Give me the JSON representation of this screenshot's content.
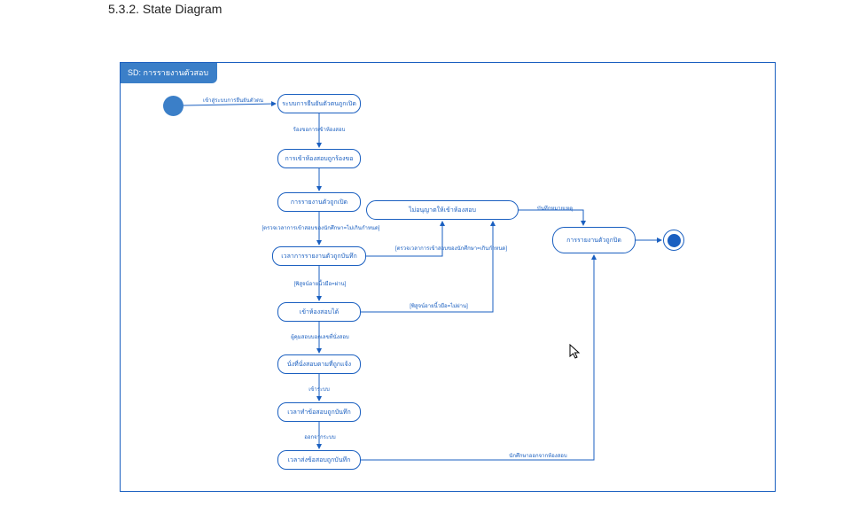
{
  "section_title": "5.3.2. State Diagram",
  "frame_label": "SD: การรายงานตัวสอบ",
  "nodes": {
    "n1": "ระบบการยืนยันตัวตนถูกเปิด",
    "n2": "การเข้าห้องสอบถูกร้องขอ",
    "n3": "การรายงานตัวถูกเปิด",
    "n4": "เวลาการรายงานตัวถูกบันทึก",
    "n5": "เข้าห้องสอบได้",
    "n6": "นั่งที่นั่งสอบตามที่ถูกแจ้ง",
    "n7": "เวลาทำข้อสอบถูกบันทึก",
    "n8": "เวลาส่งข้อสอบถูกบันทึก",
    "n9": "ไม่อนุญาตให้เข้าห้องสอบ",
    "n10": "การรายงานตัวถูกปิด"
  },
  "edges": {
    "e_start": "เข้าสู่ระบบการยืนยันตัวตน",
    "e_12": "ร้องขอการเข้าห้องสอบ",
    "e_34": "[ตรวจเวลาการเข้าสอบของนักศึกษา=ไม่เกินกำหนด]",
    "e_49": "[ตรวจเวลาการเข้าสอบของนักศึกษา=เกินกำหนด]",
    "e_45": "[พิสูจน์อายนี้วมือ=ผ่าน]",
    "e_59": "[พิสูจน์อายนี้วมือ=ไม่ผ่าน]",
    "e_56": "ผู้คุมสอบบอกเลขที่นั่งสอบ",
    "e_67": "เข้าระบบ",
    "e_78": "ออกจากระบบ",
    "e_810": "นักศึกษาออกจากห้องสอบ",
    "e_910": "บันทึกหมายเหตุ"
  }
}
